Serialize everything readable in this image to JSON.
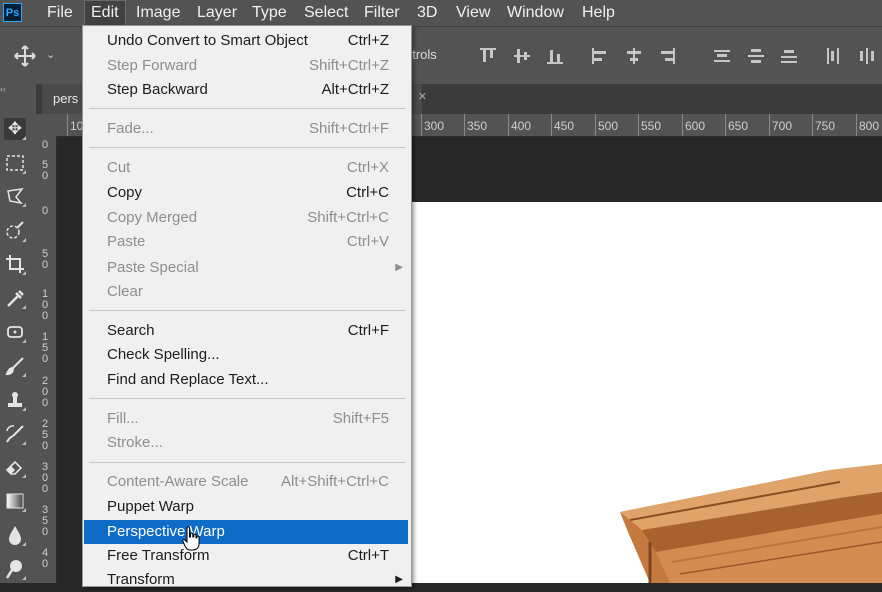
{
  "app": {
    "logo": "Ps"
  },
  "menubar": {
    "items": [
      "File",
      "Edit",
      "Image",
      "Layer",
      "Type",
      "Select",
      "Filter",
      "3D",
      "View",
      "Window",
      "Help"
    ],
    "active": "Edit"
  },
  "options_bar": {
    "partial_text": "ntrols"
  },
  "document": {
    "tab_label": "pers",
    "close_glyph": "×"
  },
  "ruler": {
    "top_labels": [
      "10",
      "300",
      "350",
      "400",
      "450",
      "500",
      "550",
      "600",
      "650",
      "700",
      "750",
      "800"
    ],
    "left_labels": [
      "0",
      "5\n0",
      "0",
      "5\n0",
      "1\n0\n0",
      "1\n5\n0",
      "2\n0\n0",
      "2\n5\n0",
      "3\n0\n0",
      "3\n5\n0",
      "4\n0"
    ]
  },
  "edit_menu": {
    "items": [
      {
        "label": "Undo Convert to Smart Object",
        "shortcut": "Ctrl+Z",
        "enabled": true
      },
      {
        "label": "Step Forward",
        "shortcut": "Shift+Ctrl+Z",
        "enabled": false
      },
      {
        "label": "Step Backward",
        "shortcut": "Alt+Ctrl+Z",
        "enabled": true
      },
      {
        "label": "Fade...",
        "shortcut": "Shift+Ctrl+F",
        "enabled": false
      },
      {
        "label": "Cut",
        "shortcut": "Ctrl+X",
        "enabled": false
      },
      {
        "label": "Copy",
        "shortcut": "Ctrl+C",
        "enabled": true
      },
      {
        "label": "Copy Merged",
        "shortcut": "Shift+Ctrl+C",
        "enabled": false
      },
      {
        "label": "Paste",
        "shortcut": "Ctrl+V",
        "enabled": false
      },
      {
        "label": "Paste Special",
        "shortcut": "",
        "enabled": false,
        "submenu": true
      },
      {
        "label": "Clear",
        "shortcut": "",
        "enabled": false
      },
      {
        "label": "Search",
        "shortcut": "Ctrl+F",
        "enabled": true
      },
      {
        "label": "Check Spelling...",
        "shortcut": "",
        "enabled": true
      },
      {
        "label": "Find and Replace Text...",
        "shortcut": "",
        "enabled": true
      },
      {
        "label": "Fill...",
        "shortcut": "Shift+F5",
        "enabled": false
      },
      {
        "label": "Stroke...",
        "shortcut": "",
        "enabled": false
      },
      {
        "label": "Content-Aware Scale",
        "shortcut": "Alt+Shift+Ctrl+C",
        "enabled": false
      },
      {
        "label": "Puppet Warp",
        "shortcut": "",
        "enabled": true
      },
      {
        "label": "Perspective Warp",
        "shortcut": "",
        "enabled": true,
        "highlighted": true
      },
      {
        "label": "Free Transform",
        "shortcut": "Ctrl+T",
        "enabled": true
      },
      {
        "label": "Transform",
        "shortcut": "",
        "enabled": true,
        "submenu": true
      }
    ],
    "submenu_glyph": "▶"
  },
  "colors": {
    "highlight": "#0f6cc6",
    "menu_bg": "#f0f0f0",
    "chrome": "#535353",
    "pasteboard": "#282828"
  }
}
